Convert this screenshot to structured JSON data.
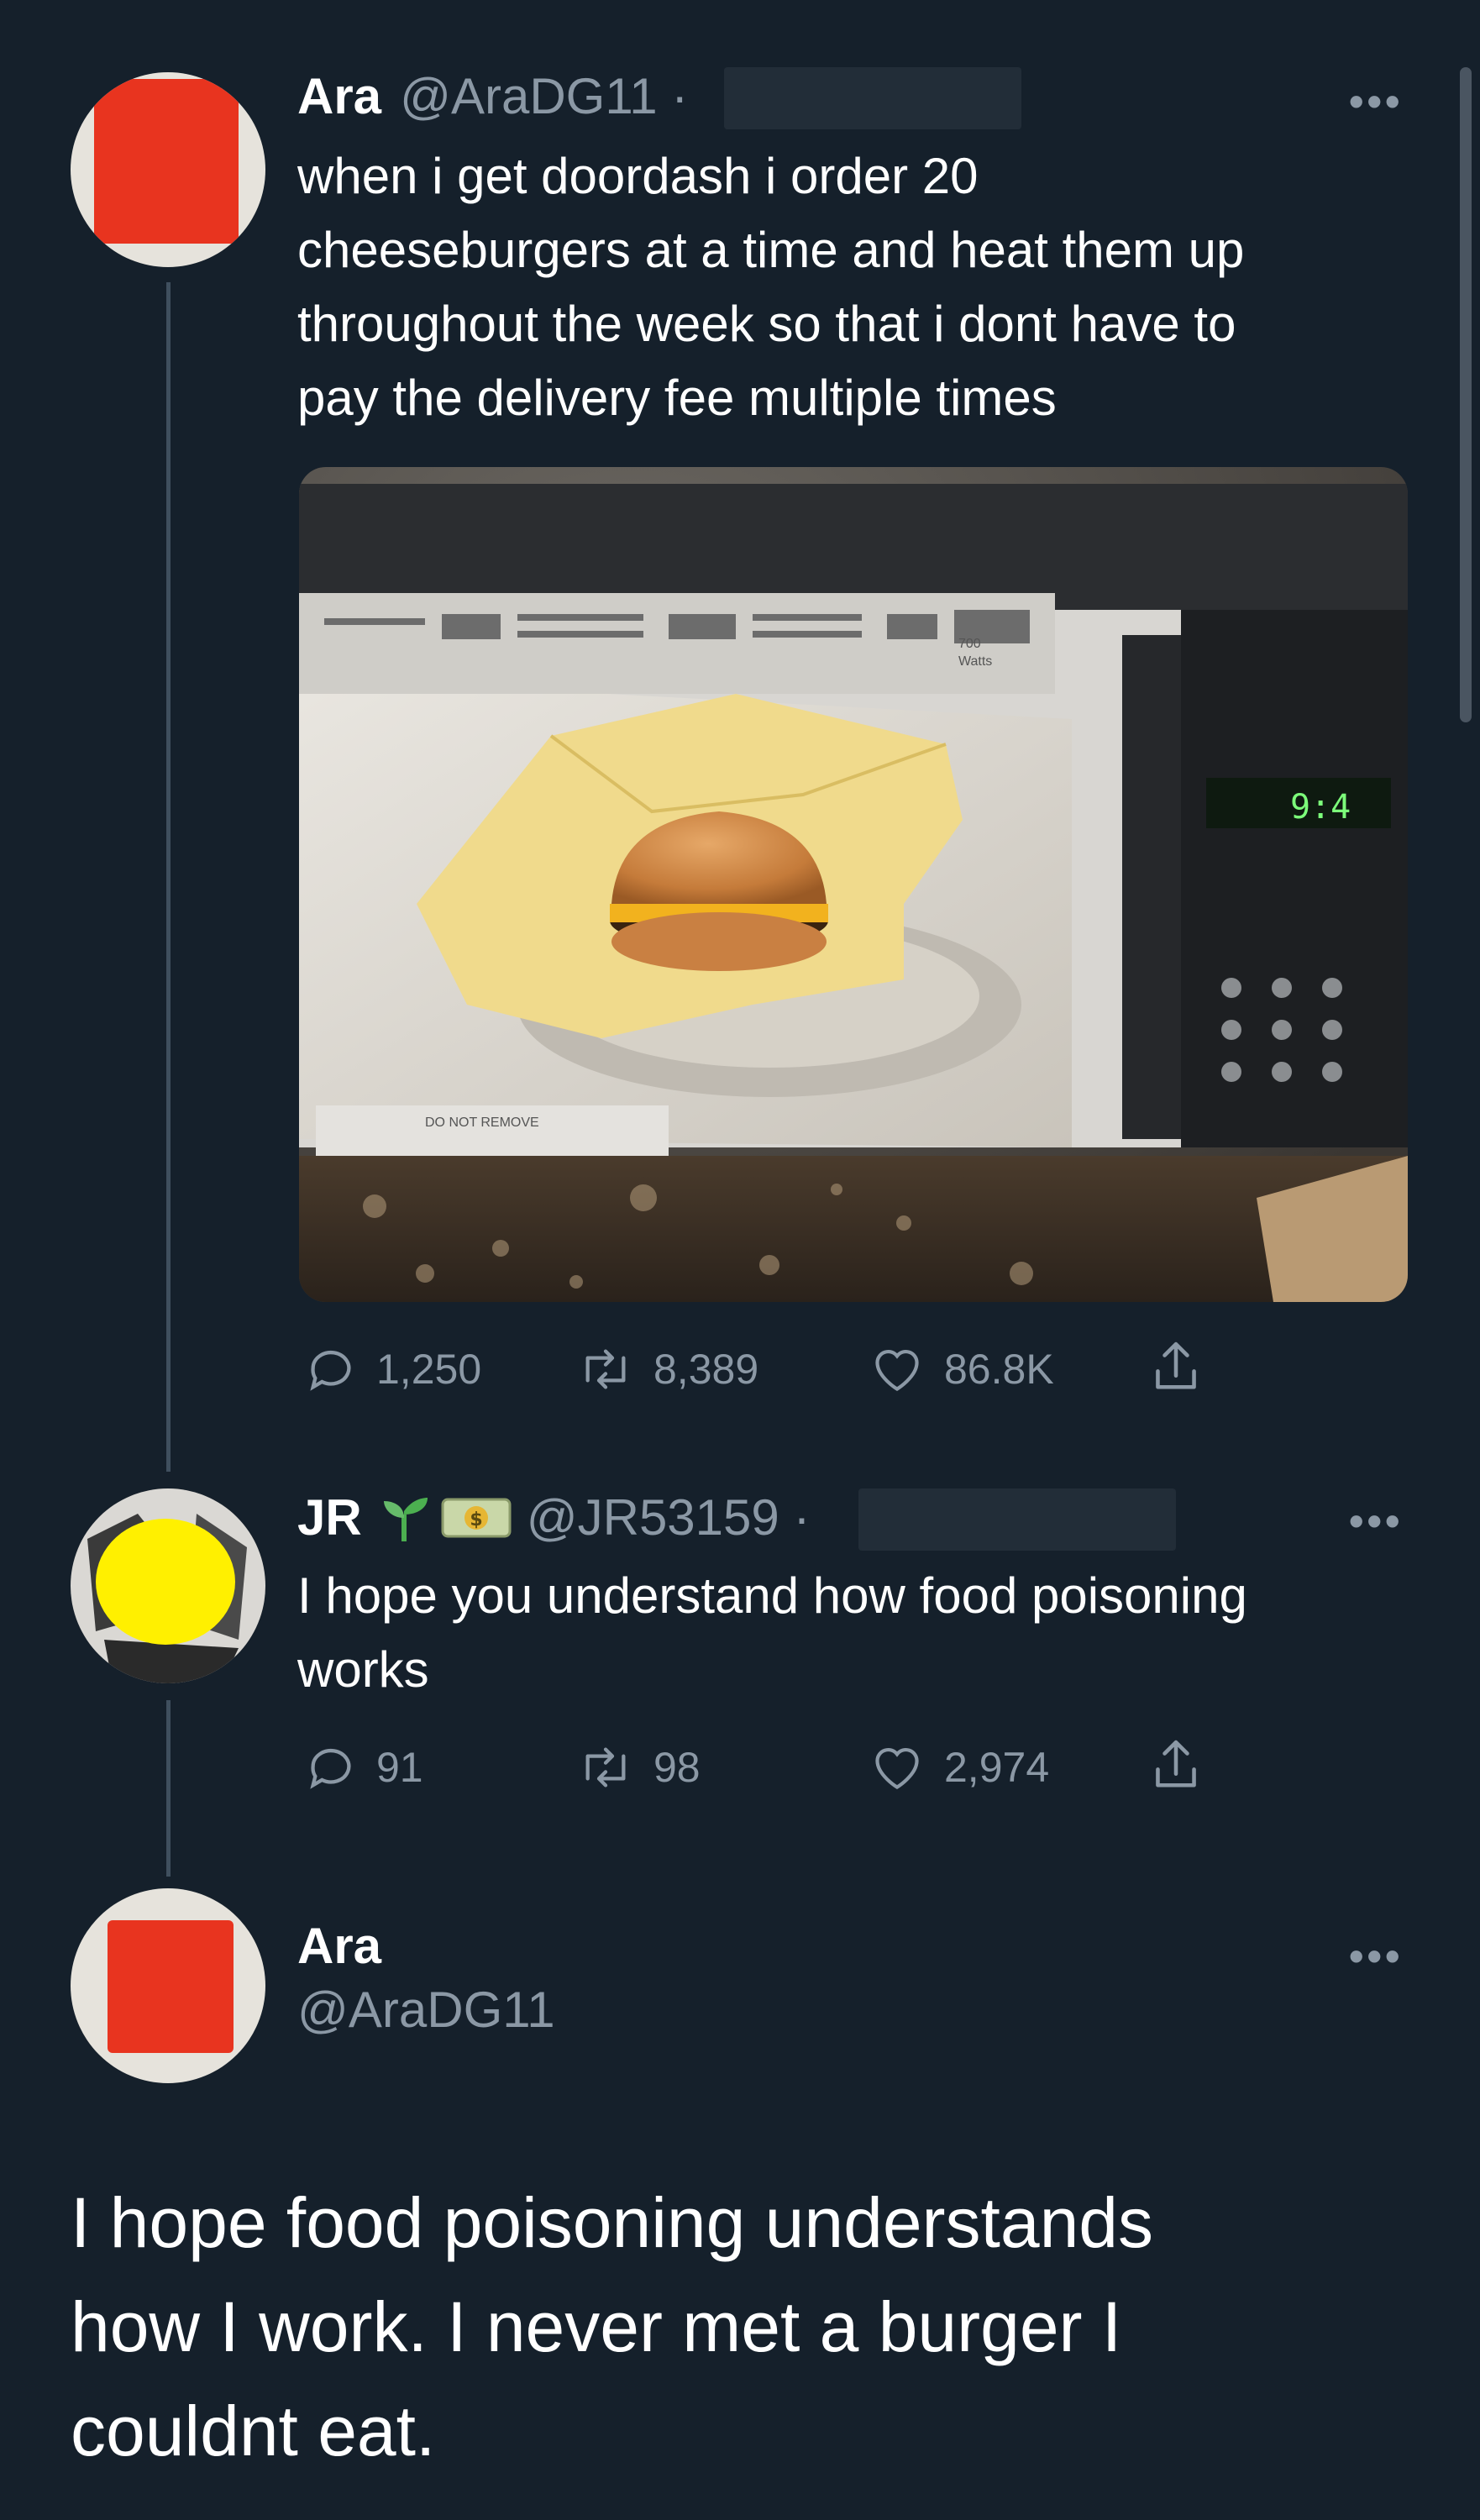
{
  "tweet1": {
    "name": "Ara",
    "handle": "@AraDG11 ·",
    "text_lines": [
      "when i get doordash i order 20",
      "cheeseburgers at a time and heat them up",
      "throughout the week so that i dont have to",
      "pay the delivery fee multiple times"
    ],
    "microwave": {
      "clock": "9:4",
      "watts_line1": "700",
      "watts_line2": "Watts",
      "label": "DO NOT REMOVE"
    },
    "stats": {
      "replies": "1,250",
      "retweets": "8,389",
      "likes": "86.8K"
    }
  },
  "tweet2": {
    "name": "JR",
    "handle": "@JR53159 ·",
    "text_lines": [
      "I hope you understand how food poisoning",
      "works"
    ],
    "stats": {
      "replies": "91",
      "retweets": "98",
      "likes": "2,974"
    }
  },
  "tweet3": {
    "name": "Ara",
    "handle": "@AraDG11",
    "text_lines": [
      "I hope food poisoning understands",
      "how I work. I never met a burger I",
      "couldnt eat."
    ]
  },
  "ui": {
    "more": "•••"
  },
  "colors": {
    "background": "#15202b",
    "secondary_text": "#8b98a5",
    "redaction_red": "#e8341f",
    "redaction_yellow": "#fff000"
  }
}
